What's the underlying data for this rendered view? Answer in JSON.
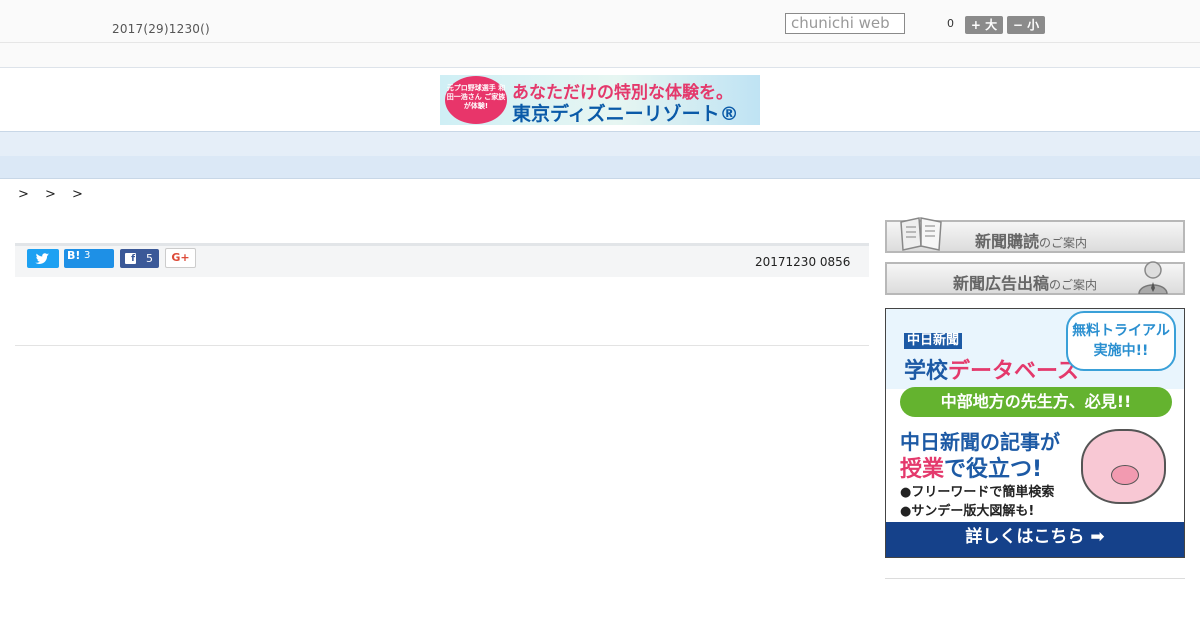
{
  "header": {
    "date": "2017(29)1230()",
    "search_placeholder": "chunichi web",
    "font_size_count": "0",
    "font_big_label": "+ 大",
    "font_small_label": "− 小"
  },
  "banner": {
    "badge_text": "元プロ野球選手 和田一浩さん ご家族が体験!",
    "line1": "あなただけの特別な体験を。",
    "line2": "東京ディズニーリゾート®"
  },
  "nav": {
    "items": [
      "",
      "",
      "",
      "",
      "",
      "",
      "",
      "",
      ""
    ]
  },
  "breadcrumb": {
    "text": "> > >"
  },
  "share": {
    "hatena_label": "B!",
    "hatena_count": "3",
    "facebook_count": "5",
    "gplus_label": "G+",
    "timestamp": "20171230 0856"
  },
  "sidebar": {
    "subscribe_label": "新聞購読",
    "subscribe_suffix": "のご案内",
    "advert_label": "新聞広告出稿",
    "advert_suffix": "のご案内"
  },
  "db_ad": {
    "logo_top": "中日新聞",
    "logo_main": "学校",
    "logo_accent": "データベース",
    "trial_line1": "無料トライアル",
    "trial_line2": "実施中!!",
    "pill": "中部地方の先生方、必見!!",
    "main1": "中日新聞の記事が",
    "main2_accent": "授業",
    "main2": "で役立つ!",
    "bullet1": "●フリーワードで簡単検索",
    "bullet2": "●サンデー版大図解も!",
    "footer": "詳しくはこちら ➡"
  },
  "colors": {
    "nav_bg": "#e5eef8",
    "twitter": "#1da1f2",
    "hatena": "#1e90e6",
    "facebook": "#3b5998",
    "db_footer": "#15418a"
  }
}
